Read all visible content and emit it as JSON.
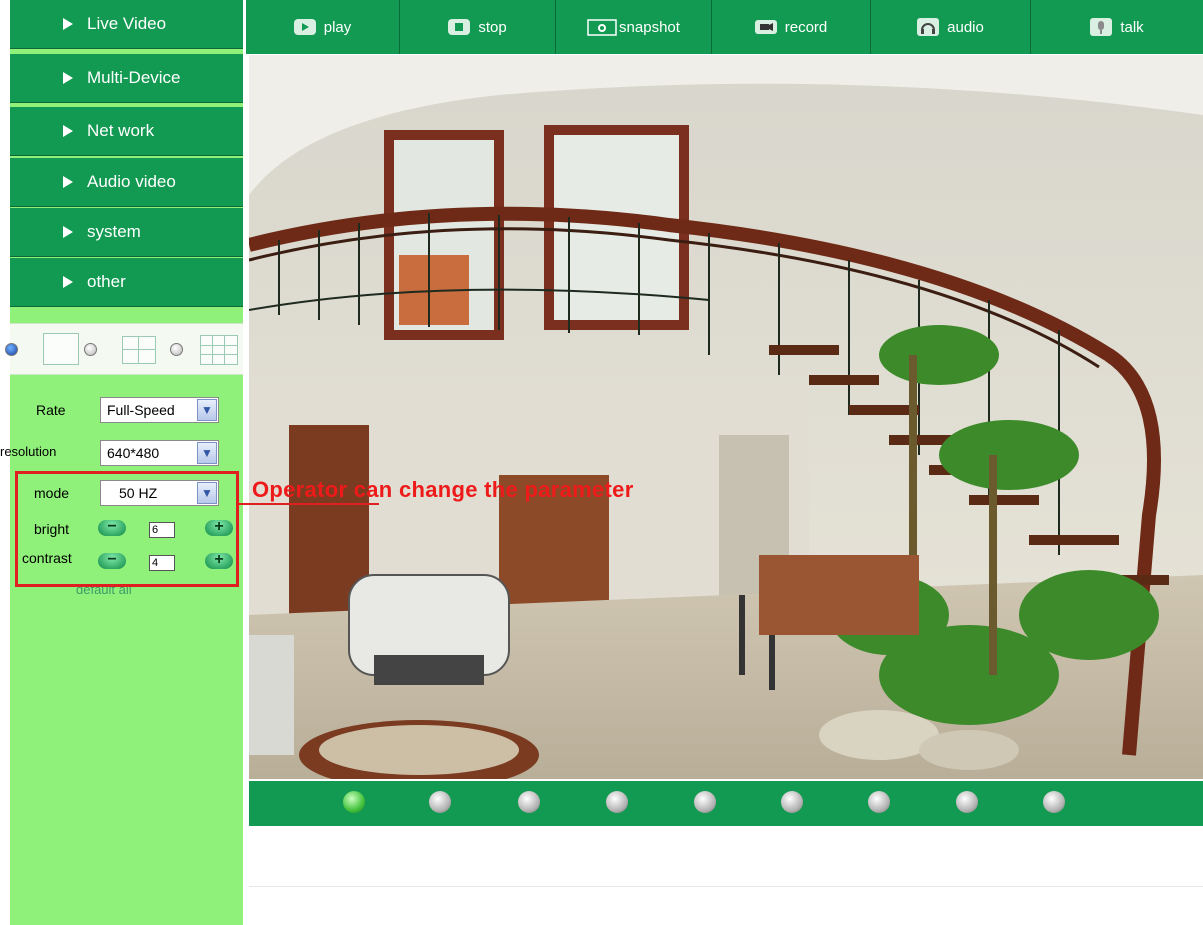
{
  "sidebar": {
    "menu": [
      {
        "label": "Live Video"
      },
      {
        "label": "Multi-Device"
      },
      {
        "label": "Net work"
      },
      {
        "label": "Audio video"
      },
      {
        "label": "system"
      },
      {
        "label": "other"
      }
    ],
    "params": {
      "rate_label": "Rate",
      "rate_value": "Full-Speed",
      "resolution_label": "resolution",
      "resolution_value": "640*480",
      "mode_label": "mode",
      "mode_value": "50 HZ",
      "bright_label": "bright",
      "bright_value": "6",
      "contrast_label": "contrast",
      "contrast_value": "4",
      "default_all": "default all"
    }
  },
  "toolbar": {
    "buttons": [
      {
        "label": "play",
        "icon": "play-icon"
      },
      {
        "label": "stop",
        "icon": "stop-icon"
      },
      {
        "label": "snapshot",
        "icon": "camera-icon"
      },
      {
        "label": "record",
        "icon": "video-camera-icon"
      },
      {
        "label": "audio",
        "icon": "headphones-icon"
      },
      {
        "label": "talk",
        "icon": "microphone-icon"
      }
    ]
  },
  "channels": {
    "count": 9,
    "active": 1
  },
  "annotation": {
    "text": "Operator can change the parameter"
  },
  "colors": {
    "menu_green": "#139a52",
    "sidebar_bg": "#8ff07a",
    "annotation_red": "#e02020"
  }
}
